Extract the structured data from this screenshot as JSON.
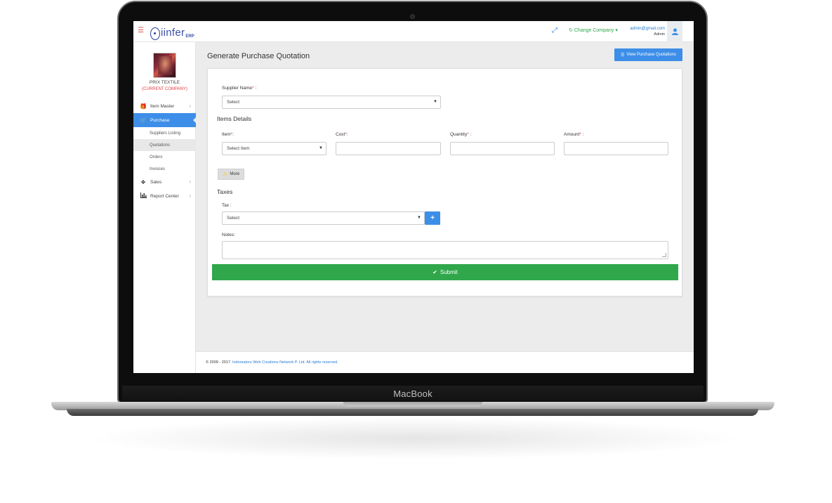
{
  "device": {
    "brand": "MacBook"
  },
  "topbar": {
    "logo_text": "iinfer",
    "logo_suffix": "ERP",
    "change_company": "Change Company",
    "admin_email": "admin@gmail.com",
    "admin_role": "Admin"
  },
  "sidebar": {
    "company_name": "PRIX TEXTILE",
    "company_tag": "(CURRENT COMPANY)",
    "items": [
      {
        "label": "Item Master",
        "icon": "gift-icon"
      },
      {
        "label": "Purchase",
        "icon": "cart-icon"
      },
      {
        "label": "Sales",
        "icon": "tags-icon"
      },
      {
        "label": "Report Center",
        "icon": "bar-chart-icon"
      }
    ],
    "purchase_sub": [
      {
        "label": "Suppliers Listing"
      },
      {
        "label": "Quotations"
      },
      {
        "label": "Orders"
      },
      {
        "label": "Invoices"
      }
    ]
  },
  "main": {
    "title": "Generate Purchase Quotation",
    "view_button": "View Purchase Quotations",
    "supplier_label": "Supplier Name",
    "supplier_value": "Select",
    "items_details_title": "Items Details",
    "item_label": "Item",
    "item_value": "Select Item",
    "cost_label": "Cost",
    "quantity_label": "Quantity",
    "amount_label": "Amount",
    "more_button": "More",
    "taxes_title": "Taxes",
    "tax_label": "Tax :",
    "tax_value": "Select",
    "notes_label": "Notes:",
    "submit_button": "Submit"
  },
  "footer": {
    "copyright": "© 2009 - 2017",
    "company_link": "Indoreators Web Creations Network P. Ltd. All rights reserved."
  },
  "colors": {
    "primary": "#3d8ee8",
    "success": "#2fa74a",
    "danger": "#e04040"
  }
}
